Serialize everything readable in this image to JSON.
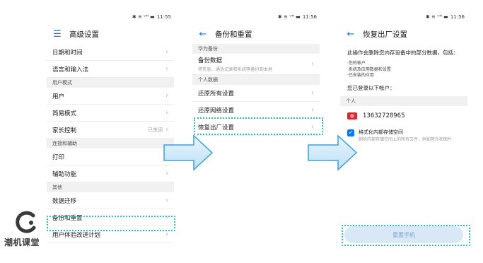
{
  "status_bar": {
    "icons": "✱ ≋ ᵛ⁴ˡ ▬",
    "time_1": "11:55",
    "time_2": "11:56",
    "time_3": "11:56"
  },
  "screen1": {
    "title": "高级设置",
    "menu_icon": "menu-icon",
    "rows_top": [
      {
        "label": "日期和时间"
      },
      {
        "label": "语言和输入法"
      }
    ],
    "section_user": "用户模式",
    "rows_user": [
      {
        "label": "用户"
      },
      {
        "label": "简易模式"
      },
      {
        "label": "家长控制",
        "value": "已关闭"
      }
    ],
    "section_access": "连接和辅助",
    "rows_access": [
      {
        "label": "打印"
      },
      {
        "label": "辅助功能"
      }
    ],
    "section_other": "其他",
    "rows_other": [
      {
        "label": "数据迁移"
      },
      {
        "label": "备份和重置"
      },
      {
        "label": "用户体验改进计划"
      }
    ]
  },
  "screen2": {
    "title": "备份和重置",
    "section_huawei": "华为备份",
    "backup": {
      "label": "备份数据",
      "sub": "将信息、通话记录和系统等备份到本地"
    },
    "section_personal": "个人数据",
    "rows": [
      {
        "label": "还原所有设置"
      },
      {
        "label": "还原网络设置"
      },
      {
        "label": "恢复出厂设置"
      }
    ]
  },
  "screen3": {
    "title": "恢复出厂设置",
    "desc": "此操作会删除您内存设备中的部分数据，包括：",
    "bullets": [
      "·您的帐户",
      "·系统及应用数据和设置",
      "·已安装的应用"
    ],
    "logged_in": "您已登录以下帐户：",
    "section_personal": "个人",
    "account": "13632728965",
    "format_title": "格式化内部存储空间",
    "format_sub": "删除内部存储空间上的所有文件，例如音乐和图片",
    "reset_button": "重置手机"
  },
  "brand": {
    "logo_text": "潮机课堂"
  },
  "colors": {
    "accent": "#007dff",
    "highlight": "#2bbfbf",
    "arrow": "#3aa0e0",
    "huawei_red": "#e0252c"
  }
}
